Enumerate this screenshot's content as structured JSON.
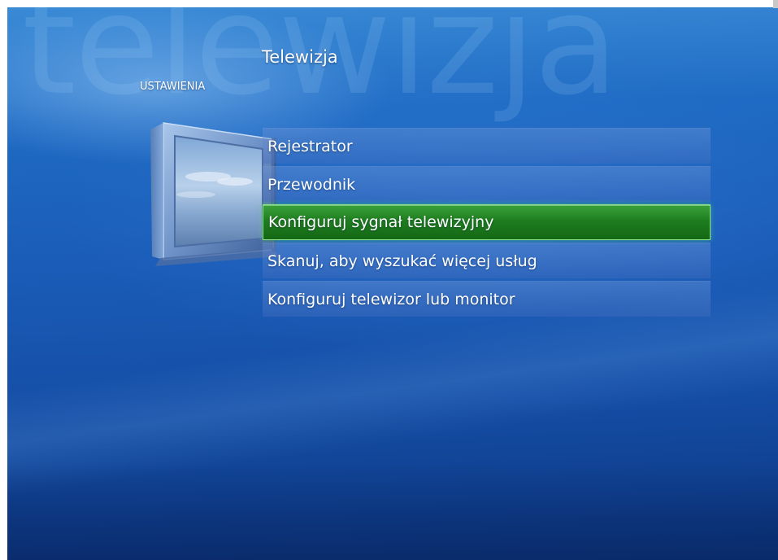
{
  "watermark": "telewizja",
  "header": {
    "title": "Telewizja",
    "section": "USTAWIENIA"
  },
  "menu": {
    "items": [
      {
        "label": "Rejestrator",
        "selected": false
      },
      {
        "label": "Przewodnik",
        "selected": false
      },
      {
        "label": "Konfiguruj sygnał telewizyjny",
        "selected": true
      },
      {
        "label": "Skanuj, aby wyszukać więcej usług",
        "selected": false
      },
      {
        "label": "Konfiguruj telewizor lub monitor",
        "selected": false
      }
    ]
  },
  "colors": {
    "background": "#1a5cb8",
    "selected_item": "#1f7d1f",
    "selected_border": "#8fe08f",
    "text": "#ffffff"
  },
  "icons": {
    "illustration": "television-icon"
  }
}
